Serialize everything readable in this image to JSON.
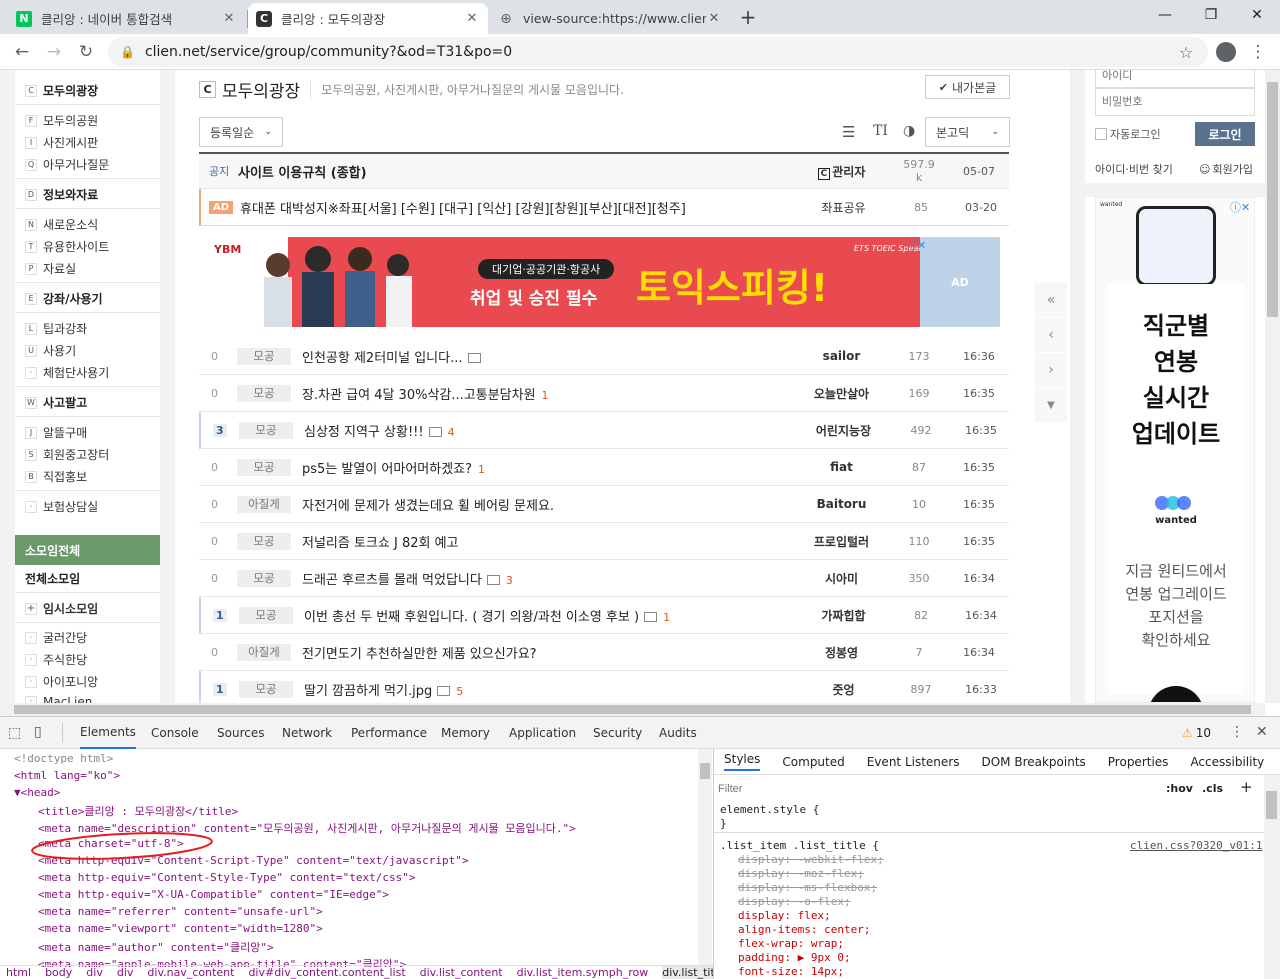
{
  "browser": {
    "tabs": [
      {
        "title": "클리앙 : 네이버 통합검색",
        "favicon": "N"
      },
      {
        "title": "클리앙 : 모두의광장",
        "favicon": "C"
      },
      {
        "title": "view-source:https://www.clien.ne",
        "favicon": "globe"
      }
    ],
    "url": "clien.net/service/group/community?&od=T31&po=0"
  },
  "leftnav": {
    "groups": [
      {
        "label": "모두의광장",
        "letter": "C",
        "items": [
          {
            "letter": "F",
            "label": "모두의공원"
          },
          {
            "letter": "I",
            "label": "사진게시판"
          },
          {
            "letter": "Q",
            "label": "아무거나질문"
          }
        ]
      },
      {
        "label": "정보와자료",
        "letter": "D",
        "items": [
          {
            "letter": "N",
            "label": "새로운소식"
          },
          {
            "letter": "T",
            "label": "유용한사이트"
          },
          {
            "letter": "P",
            "label": "자료실"
          }
        ]
      },
      {
        "label": "강좌/사용기",
        "letter": "E",
        "items": [
          {
            "letter": "L",
            "label": "팁과강좌"
          },
          {
            "letter": "U",
            "label": "사용기"
          },
          {
            "letter": "·",
            "label": "체험단사용기"
          }
        ]
      },
      {
        "label": "사고팔고",
        "letter": "W",
        "items": [
          {
            "letter": "J",
            "label": "알뜰구매"
          },
          {
            "letter": "S",
            "label": "회원중고장터"
          },
          {
            "letter": "B",
            "label": "직접홍보"
          }
        ]
      }
    ],
    "insurance": "보험상담실",
    "somoim_header": "소모임전체",
    "somoim_all": "전체소모임",
    "temp_somoim": "임시소모임",
    "somoim_items": [
      "굴러간당",
      "주식한당",
      "아이포니앙",
      "MacLien"
    ]
  },
  "board": {
    "icon_letter": "C",
    "title": "모두의광장",
    "description": "모두의공원, 사진게시판, 아무거나질문의 게시물 모음입니다.",
    "my_posts_button": "내가본글",
    "sort_select": "등록일순",
    "font_select": "본고딕",
    "notice": {
      "tag": "공지",
      "subject": "사이트 이용규칙 (종합)",
      "author": "관리자",
      "hits": "597.9 k",
      "time": "05-07"
    },
    "ad_row": {
      "tag": "AD",
      "subject": "휴대폰 대박성지※좌표[서울] [수원] [대구] [익산] [강원][창원][부산][대전][청주]",
      "author": "좌표공유",
      "hits": "85",
      "time": "03-20"
    },
    "banner": {
      "pill": "대기업·공공기관·항공사",
      "left_text": "취업 및 승진 필수",
      "big_text": "토익스피킹!",
      "brand": "ETS TOEIC Speaking",
      "ad_label": "AD",
      "logo": "YBM"
    },
    "rows": [
      {
        "count": "0",
        "cat": "모공",
        "subject": "인천공항 제2터미널 입니다...",
        "pic": true,
        "comments": "",
        "author": "sailor",
        "hits": "173",
        "time": "16:36",
        "hot": false
      },
      {
        "count": "0",
        "cat": "모공",
        "subject": "장.차관 급여 4달 30%삭감...고통분담차원",
        "pic": false,
        "comments": "1",
        "author": "오늘만살아",
        "hits": "169",
        "time": "16:35",
        "hot": false
      },
      {
        "count": "3",
        "cat": "모공",
        "subject": "심상정 지역구 상황!!!",
        "pic": true,
        "comments": "4",
        "author": "어린지능장",
        "hits": "492",
        "time": "16:35",
        "hot": true
      },
      {
        "count": "0",
        "cat": "모공",
        "subject": "ps5는 발열이 어마어머하겠죠?",
        "pic": false,
        "comments": "1",
        "author": "fiat",
        "hits": "87",
        "time": "16:35",
        "hot": false
      },
      {
        "count": "0",
        "cat": "아질게",
        "subject": "자전거에 문제가 생겼는데요 휠 베어링 문제요.",
        "pic": false,
        "comments": "",
        "author": "Baitoru",
        "hits": "10",
        "time": "16:35",
        "hot": false
      },
      {
        "count": "0",
        "cat": "모공",
        "subject": "저널리즘 토크쇼 J 82회 예고",
        "pic": false,
        "comments": "",
        "author": "프로입털러",
        "hits": "110",
        "time": "16:35",
        "hot": false
      },
      {
        "count": "0",
        "cat": "모공",
        "subject": "드래곤 후르츠를 몰래 먹었답니다",
        "pic": true,
        "comments": "3",
        "author": "시아미",
        "hits": "350",
        "time": "16:34",
        "hot": false
      },
      {
        "count": "1",
        "cat": "모공",
        "subject": "이번 총선 두 번째 후원입니다. ( 경기 의왕/과천 이소영 후보 )",
        "pic": true,
        "comments": "1",
        "author": "가짜힙합",
        "hits": "82",
        "time": "16:34",
        "hot": true
      },
      {
        "count": "0",
        "cat": "아질게",
        "subject": "전기면도기 추천하실만한 제품 있으신가요?",
        "pic": false,
        "comments": "",
        "author": "정봉영",
        "hits": "7",
        "time": "16:34",
        "hot": false
      },
      {
        "count": "1",
        "cat": "모공",
        "subject": "딸기 깜끔하게 먹기.jpg",
        "pic": true,
        "comments": "5",
        "author": "줏엉",
        "hits": "897",
        "time": "16:33",
        "hot": true
      }
    ]
  },
  "login": {
    "id_placeholder": "아이디",
    "pw_placeholder": "비밀번호",
    "auto_login": "자동로그인",
    "login_button": "로그인",
    "find_link": "아이디·비번 찾기",
    "join_link": "회원가입"
  },
  "side_ad": {
    "brand_small": "wanted",
    "line1": "직군별",
    "line2": "연봉",
    "line3": "실시간",
    "line4": "업데이트",
    "brand": "wanted",
    "sub1": "지금 원티드에서",
    "sub2": "연봉 업그레이드",
    "sub3": "포지션을",
    "sub4": "확인하세요"
  },
  "devtools": {
    "tabs": [
      "Elements",
      "Console",
      "Sources",
      "Network",
      "Performance",
      "Memory",
      "Application",
      "Security",
      "Audits"
    ],
    "warnings": "10",
    "code_lines": [
      "<!doctype html>",
      "<html lang=\"ko\">",
      "▼<head>",
      "<title>클리앙 : 모두의광장</title>",
      "<meta name=\"description\" content=\"모두의공원, 사진게시판, 아무거나질문의 게시물 모음입니다.\">",
      "<meta charset=\"utf-8\">",
      "<meta http-equiv=\"Content-Script-Type\" content=\"text/javascript\">",
      "<meta http-equiv=\"Content-Style-Type\" content=\"text/css\">",
      "<meta http-equiv=\"X-UA-Compatible\" content=\"IE=edge\">",
      "<meta name=\"referrer\" content=\"unsafe-url\">",
      "<meta name=\"viewport\" content=\"width=1280\">",
      "<meta name=\"author\" content=\"클리앙\">",
      "<meta name=\"apple-mobile-web-app-title\" content=\"클리앙\">"
    ],
    "breadcrumbs": [
      "html",
      "body",
      "div",
      "div",
      "div.nav_content",
      "div#div_content.content_list",
      "div.list_content",
      "div.list_item.symph_row",
      "div.list_title"
    ],
    "style_tabs": [
      "Styles",
      "Computed",
      "Event Listeners",
      "DOM Breakpoints",
      "Properties",
      "Accessibility"
    ],
    "filter_placeholder": "Filter",
    "hov": ":hov",
    "cls": ".cls",
    "element_style": "element.style {",
    "close_brace": "}",
    "selector": ".list_item .list_title {",
    "source_link": "clien.css?0320_v01:1",
    "rules": [
      {
        "text": "display: -webkit-flex;",
        "struck": true
      },
      {
        "text": "display: -moz-flex;",
        "struck": true
      },
      {
        "text": "display: -ms-flexbox;",
        "struck": true
      },
      {
        "text": "display: -o-flex;",
        "struck": true
      },
      {
        "text": "display: flex;",
        "struck": false
      },
      {
        "text": "align-items: center;",
        "struck": false
      },
      {
        "text": "flex-wrap: wrap;",
        "struck": false
      },
      {
        "text": "padding: ▶ 9px 0;",
        "struck": false
      },
      {
        "text": "font-size: 14px;",
        "struck": false
      }
    ]
  },
  "colors": {
    "accent_green": "#6a9a6a",
    "annotation_red": "#e31d1d",
    "banner_red": "#e84a4f",
    "banner_yellow": "#ffde00"
  }
}
